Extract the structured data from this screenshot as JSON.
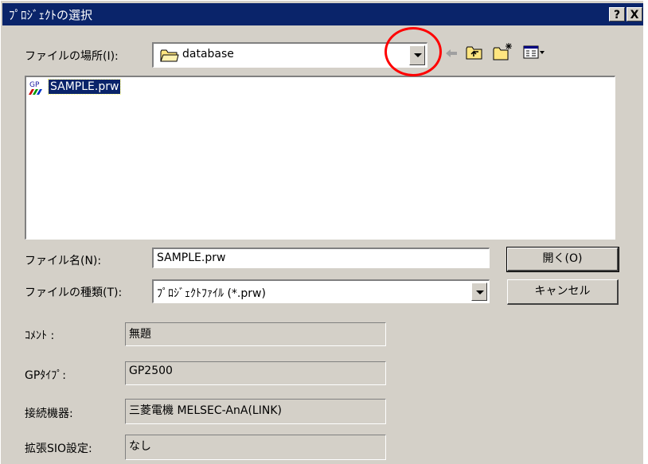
{
  "window": {
    "title": "ﾌﾟﾛｼﾞｪｸﾄの選択",
    "help_label": "?",
    "close_label": "X"
  },
  "location": {
    "label": "ファイルの場所(I):",
    "value": "database",
    "folder_icon": "folder-icon"
  },
  "toolbar": {
    "icons": [
      "back-arrow-icon",
      "up-folder-icon",
      "new-folder-icon",
      "view-menu-icon"
    ]
  },
  "file_list": {
    "items": [
      {
        "name": "SAMPLE.prw",
        "icon": "gp-project-file-icon",
        "selected": true
      }
    ]
  },
  "filename": {
    "label": "ファイル名(N):",
    "value": "SAMPLE.prw"
  },
  "filetype": {
    "label": "ファイルの種類(T):",
    "value": "ﾌﾟﾛｼﾞｪｸﾄﾌｧｲﾙ (*.prw)"
  },
  "buttons": {
    "open": "開く(O)",
    "cancel": "キャンセル"
  },
  "info": [
    {
      "label": "ｺﾒﾝﾄ :",
      "value": "無題"
    },
    {
      "label": "GPﾀｲﾌﾟ:",
      "value": "GP2500"
    },
    {
      "label": "接続機器:",
      "value": "三菱電機 MELSEC-AnA(LINK)"
    },
    {
      "label": "拡張SIO設定:",
      "value": "なし"
    }
  ],
  "annotation": {
    "color": "#ff0000"
  }
}
